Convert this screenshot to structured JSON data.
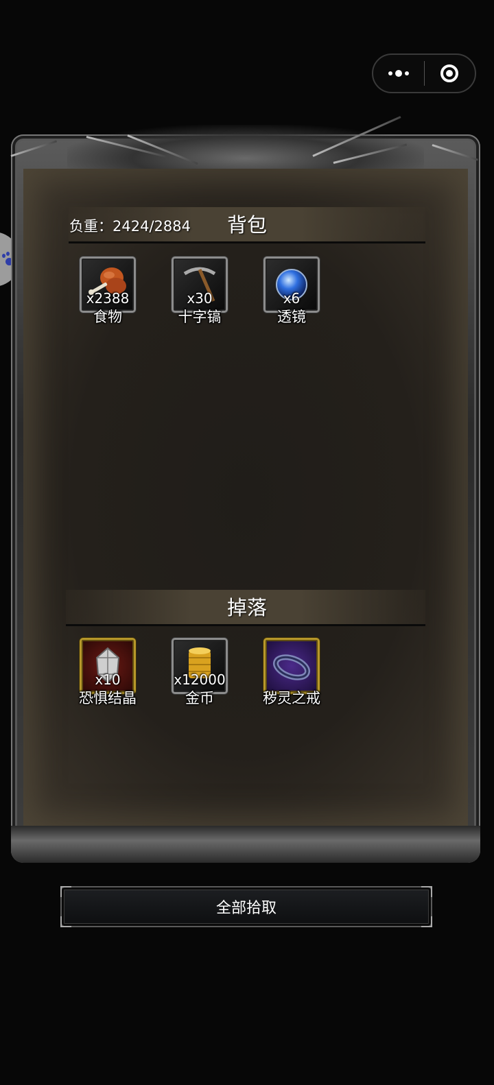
{
  "capsule": {
    "more_icon": "more-dots-icon",
    "close_icon": "target-close-icon"
  },
  "floating_tab": {
    "icon": "paw-icon"
  },
  "inventory": {
    "weight_text": "负重：2424/2884",
    "title": "背包",
    "items": [
      {
        "name": "食物",
        "count": "x2388",
        "icon": "drumstick-icon"
      },
      {
        "name": "十字镐",
        "count": "x30",
        "icon": "pickaxe-icon"
      },
      {
        "name": "透镜",
        "count": "x6",
        "icon": "lens-orb-icon"
      }
    ]
  },
  "drops": {
    "title": "掉落",
    "items": [
      {
        "name": "恐惧结晶",
        "count": "x10",
        "icon": "crystal-icon"
      },
      {
        "name": "金币",
        "count": "x12000",
        "icon": "gold-coins-icon"
      },
      {
        "name": "秽灵之戒",
        "count": "",
        "icon": "ring-icon"
      }
    ]
  },
  "action_button": {
    "label": "全部拾取"
  },
  "colors": {
    "accent_gold": "#b7982a",
    "panel_bg": "#221e19",
    "text": "#ffffff"
  }
}
